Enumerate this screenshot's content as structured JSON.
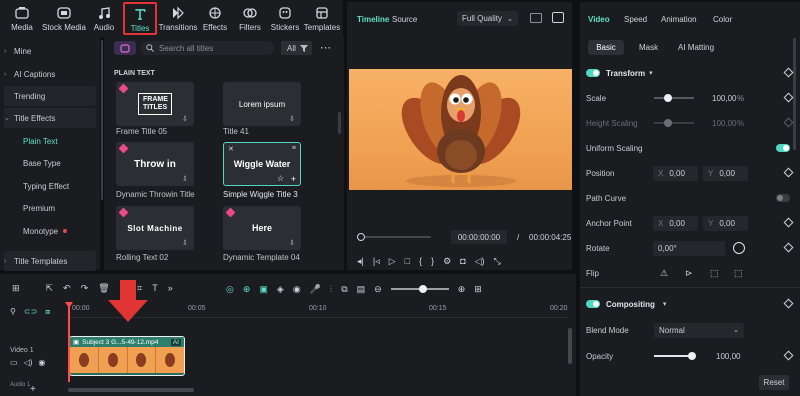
{
  "toolbar": {
    "tabs": [
      {
        "label": "Media",
        "icon": "media-icon"
      },
      {
        "label": "Stock Media",
        "icon": "stock-media-icon"
      },
      {
        "label": "Audio",
        "icon": "audio-icon"
      },
      {
        "label": "Titles",
        "icon": "titles-icon"
      },
      {
        "label": "Transitions",
        "icon": "transitions-icon"
      },
      {
        "label": "Effects",
        "icon": "effects-icon"
      },
      {
        "label": "Filters",
        "icon": "filters-icon"
      },
      {
        "label": "Stickers",
        "icon": "stickers-icon"
      },
      {
        "label": "Templates",
        "icon": "templates-icon"
      }
    ]
  },
  "sidebar": {
    "items": [
      {
        "label": "Mine"
      },
      {
        "label": "AI Captions"
      },
      {
        "label": "Trending"
      },
      {
        "label": "Title Effects"
      },
      {
        "label": "Plain Text"
      },
      {
        "label": "Base Type"
      },
      {
        "label": "Typing Effect"
      },
      {
        "label": "Premium"
      },
      {
        "label": "Monotype"
      },
      {
        "label": "Title Templates"
      }
    ]
  },
  "browser": {
    "search_placeholder": "Search all titles",
    "filter_label": "All",
    "section": "PLAIN TEXT",
    "tiles": [
      {
        "name": "Frame Title 05",
        "preview": "FRAME TITLES"
      },
      {
        "name": "Title 41",
        "preview": "Lorem ipsum"
      },
      {
        "name": "Dynamic Throwin Title",
        "preview": "Throw in"
      },
      {
        "name": "Simple Wiggle Title 3",
        "preview": "Wiggle Water"
      },
      {
        "name": "Rolling Text 02",
        "preview": "Slot Machine"
      },
      {
        "name": "Dynamic Template 04",
        "preview": "Here"
      }
    ]
  },
  "preview": {
    "tab_timeline": "Timeline",
    "tab_source": "Source",
    "quality": "Full Quality",
    "current_time": "00:00:00:00",
    "separator": "/",
    "total_time": "00:00:04:25"
  },
  "props": {
    "tabs": [
      "Video",
      "Speed",
      "Animation",
      "Color"
    ],
    "subtabs": [
      "Basic",
      "Mask",
      "AI Matting"
    ],
    "transform": "Transform",
    "scale_label": "Scale",
    "scale_value": "100,00",
    "scale_unit": "%",
    "height_label": "Height Scaling",
    "height_value": "100,00",
    "height_unit": "%",
    "uniform_label": "Uniform Scaling",
    "position_label": "Position",
    "pos_x_label": "X",
    "pos_x": "0,00",
    "pos_y_label": "Y",
    "pos_y": "0,00",
    "path_label": "Path Curve",
    "anchor_label": "Anchor Point",
    "anc_x_label": "X",
    "anc_x": "0,00",
    "anc_y_label": "Y",
    "anc_y": "0,00",
    "rotate_label": "Rotate",
    "rotate_value": "0,00°",
    "flip_label": "Flip",
    "compositing": "Compositing",
    "blend_label": "Blend Mode",
    "blend_value": "Normal",
    "opacity_label": "Opacity",
    "opacity_value": "100,00",
    "reset": "Reset"
  },
  "timeline": {
    "ticks": [
      "00:00",
      "00:05",
      "00:10",
      "00:15",
      "00:20"
    ],
    "track_label": "Video 1",
    "clip_label": "Subject 3 G...5-49-12.mp4",
    "ai_badge": "AI",
    "audio_label": "Audio 1"
  },
  "colors": {
    "accent": "#4fd8c0",
    "highlight": "#e13434",
    "playhead": "#ff4d4d"
  }
}
